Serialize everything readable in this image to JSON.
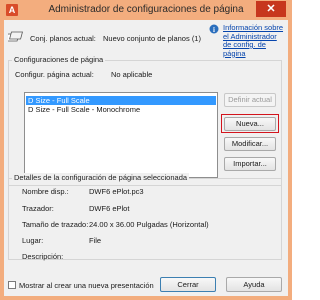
{
  "window": {
    "title": "Administrador de configuraciones de página",
    "app_icon_glyph": "A",
    "close_glyph": "✕"
  },
  "current_layout": {
    "label": "Conj. planos actual:",
    "value": "Nuevo conjunto de planos (1)",
    "info_link": "Información sobre el Administrador de config. de página"
  },
  "page_setups": {
    "group_title": "Configuraciones de página",
    "current_label": "Configur. página actual:",
    "current_value": "No aplicable",
    "items": [
      {
        "label": "D Size - Full Scale",
        "selected": true
      },
      {
        "label": "D Size - Full Scale - Monochrome",
        "selected": false
      }
    ],
    "buttons": {
      "set_current": "Definir actual",
      "new": "Nueva...",
      "modify": "Modificar...",
      "import": "Importar..."
    }
  },
  "details": {
    "group_title": "Detalles de la configuración de página seleccionada",
    "rows": [
      {
        "label": "Nombre disp.:",
        "value": "DWF6 ePlot.pc3"
      },
      {
        "label": "Trazador:",
        "value": "DWF6 ePlot"
      },
      {
        "label": "Tamaño de trazado:",
        "value": "24.00 x 36.00 Pulgadas (Horizontal)"
      },
      {
        "label": "Lugar:",
        "value": "File"
      },
      {
        "label": "Descripción:",
        "value": ""
      }
    ]
  },
  "footer": {
    "checkbox_label": "Mostrar al crear una nueva presentación",
    "close_button": "Cerrar",
    "help_button": "Ayuda"
  },
  "colors": {
    "titlebar": "#f3ad7e",
    "close_button": "#c7361d",
    "selection": "#3399ff",
    "highlight_border": "#d3141d"
  }
}
